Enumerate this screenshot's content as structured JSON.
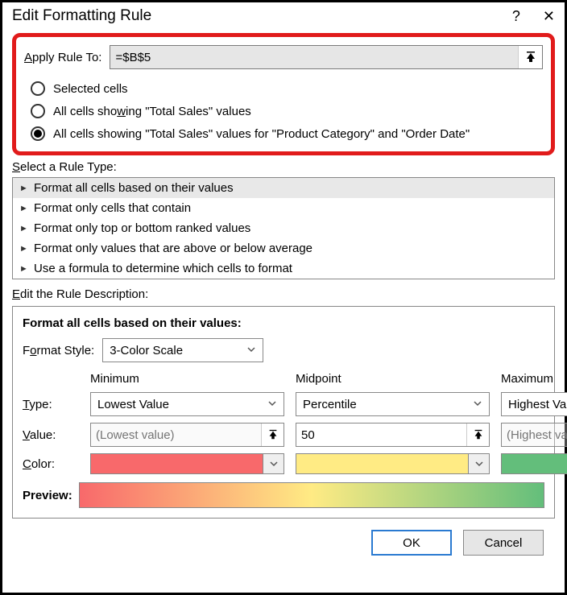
{
  "titlebar": {
    "title": "Edit Formatting Rule",
    "help": "?",
    "close": "✕"
  },
  "apply": {
    "label": "Apply Rule To:",
    "value": "=$B$5",
    "options": [
      {
        "label": "Selected cells",
        "selected": false
      },
      {
        "label": "All cells showing \"Total Sales\" values",
        "selected": false
      },
      {
        "label": "All cells showing \"Total Sales\" values for \"Product Category\" and \"Order Date\"",
        "selected": true
      }
    ]
  },
  "rule_type": {
    "label": "Select a Rule Type:",
    "items": [
      "Format all cells based on their values",
      "Format only cells that contain",
      "Format only top or bottom ranked values",
      "Format only values that are above or below average",
      "Use a formula to determine which cells to format"
    ],
    "selected_index": 0
  },
  "desc": {
    "label": "Edit the Rule Description:",
    "title": "Format all cells based on their values:",
    "format_style_label": "Format Style:",
    "format_style_value": "3-Color Scale",
    "col_headers": [
      "Minimum",
      "Midpoint",
      "Maximum"
    ],
    "row_labels": {
      "type": "Type:",
      "value": "Value:",
      "color": "Color:",
      "preview": "Preview:"
    },
    "cols": {
      "min": {
        "type": "Lowest Value",
        "value_placeholder": "(Lowest value)",
        "value": "",
        "color": "#f8696b"
      },
      "mid": {
        "type": "Percentile",
        "value": "50",
        "color": "#ffeb84"
      },
      "max": {
        "type": "Highest Value",
        "value_placeholder": "(Highest value)",
        "value": "",
        "color": "#63be7b"
      }
    }
  },
  "footer": {
    "ok": "OK",
    "cancel": "Cancel"
  }
}
